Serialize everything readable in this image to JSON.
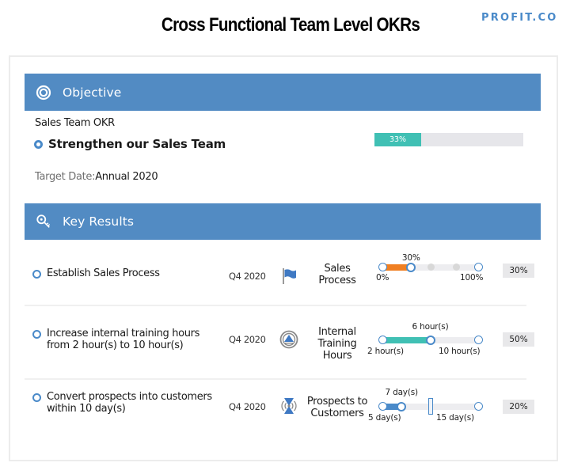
{
  "page": {
    "title": "Cross Functional Team Level OKRs",
    "brand": "PROFIT.CO"
  },
  "objective": {
    "header_label": "Objective",
    "header_icon": "target-icon",
    "team": "Sales Team OKR",
    "title": "Strengthen our Sales Team",
    "target_date_label": "Target Date:",
    "target_date_value": "Annual 2020",
    "progress_percent": 33,
    "progress_label": "33%",
    "progress_color": "#40c0b4"
  },
  "key_results": {
    "header_label": "Key Results",
    "header_icon": "key-icon",
    "items": [
      {
        "title_line1": "Establish Sales Process",
        "title_line2": "",
        "quarter": "Q4 2020",
        "icon": "flag-icon",
        "metric_line1": "Sales",
        "metric_line2": "Process",
        "metric_line3": "",
        "start_label": "0%",
        "end_label": "100%",
        "current_label": "30%",
        "target_label": "",
        "start_value": 0,
        "end_value": 100,
        "current_value": 30,
        "progress_label": "30%",
        "fill_color": "#f07f22"
      },
      {
        "title_line1": "Increase internal training hours",
        "title_line2": "from 2 hour(s) to 10 hour(s)",
        "quarter": "Q4 2020",
        "icon": "increase-arrow-icon",
        "metric_line1": "Internal",
        "metric_line2": "Training",
        "metric_line3": "Hours",
        "start_label": "2 hour(s)",
        "end_label": "10 hour(s)",
        "current_label": "6 hour(s)",
        "target_label": "",
        "start_value": 2,
        "end_value": 10,
        "current_value": 6,
        "progress_label": "50%",
        "fill_color": "#40c0b4"
      },
      {
        "title_line1": "Convert prospects into customers",
        "title_line2": "within 10 day(s)",
        "quarter": "Q4 2020",
        "icon": "signal-hourglass-icon",
        "metric_line1": "Prospects to",
        "metric_line2": "Customers",
        "metric_line3": "",
        "start_label": "5 day(s)",
        "end_label": "15 day(s)",
        "current_label": "7 day(s)",
        "target_label": "",
        "start_value": 5,
        "end_value": 15,
        "current_value": 7,
        "target_value": 10,
        "progress_label": "20%",
        "fill_color": "#4a8ac9"
      }
    ]
  }
}
